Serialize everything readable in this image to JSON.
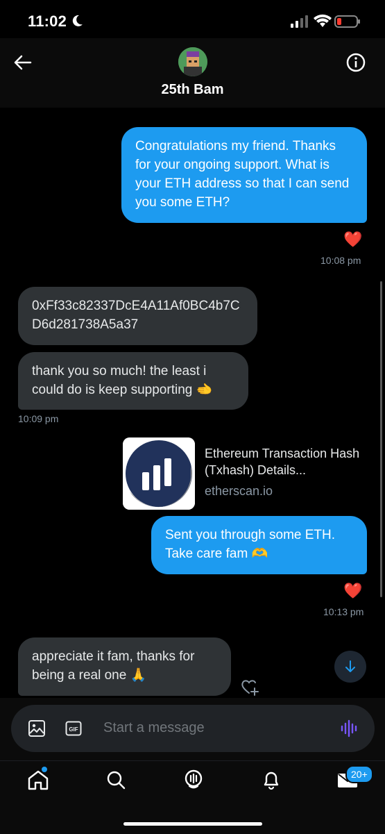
{
  "status_bar": {
    "time": "11:02"
  },
  "header": {
    "title": "25th Bam"
  },
  "messages": [
    {
      "direction": "outgoing",
      "text": "Congratulations my friend. Thanks for your ongoing support. What is your ETH address so that I can send you some ETH?",
      "reaction": "❤️",
      "time": "10:08 pm"
    },
    {
      "direction": "incoming",
      "text": "0xFf33c82337DcE4A11Af0BC4b7CD6d281738A5a37"
    },
    {
      "direction": "incoming",
      "text": "thank you so much! the least i could do is keep supporting 🫲",
      "time": "10:09 pm"
    },
    {
      "direction": "outgoing",
      "type": "link",
      "link_title": "Ethereum Transaction Hash (Txhash) Details...",
      "link_domain": "etherscan.io"
    },
    {
      "direction": "outgoing",
      "text": "Sent you through some ETH. Take care fam 🫶",
      "reaction": "❤️",
      "time": "10:13 pm"
    },
    {
      "direction": "incoming",
      "text": "appreciate it fam, thanks for being a real one 🙏"
    }
  ],
  "composer": {
    "placeholder": "Start a message"
  },
  "tabbar": {
    "messages_badge": "20+"
  },
  "colors": {
    "accent": "#1d9bf0",
    "incoming_bubble": "#2f3336",
    "background": "#000000"
  },
  "icons": [
    "back-arrow-icon",
    "info-icon",
    "image-icon",
    "gif-icon",
    "voice-icon",
    "home-icon",
    "search-icon",
    "spaces-icon",
    "bell-icon",
    "mail-icon",
    "add-reaction-icon",
    "arrow-down-icon"
  ]
}
